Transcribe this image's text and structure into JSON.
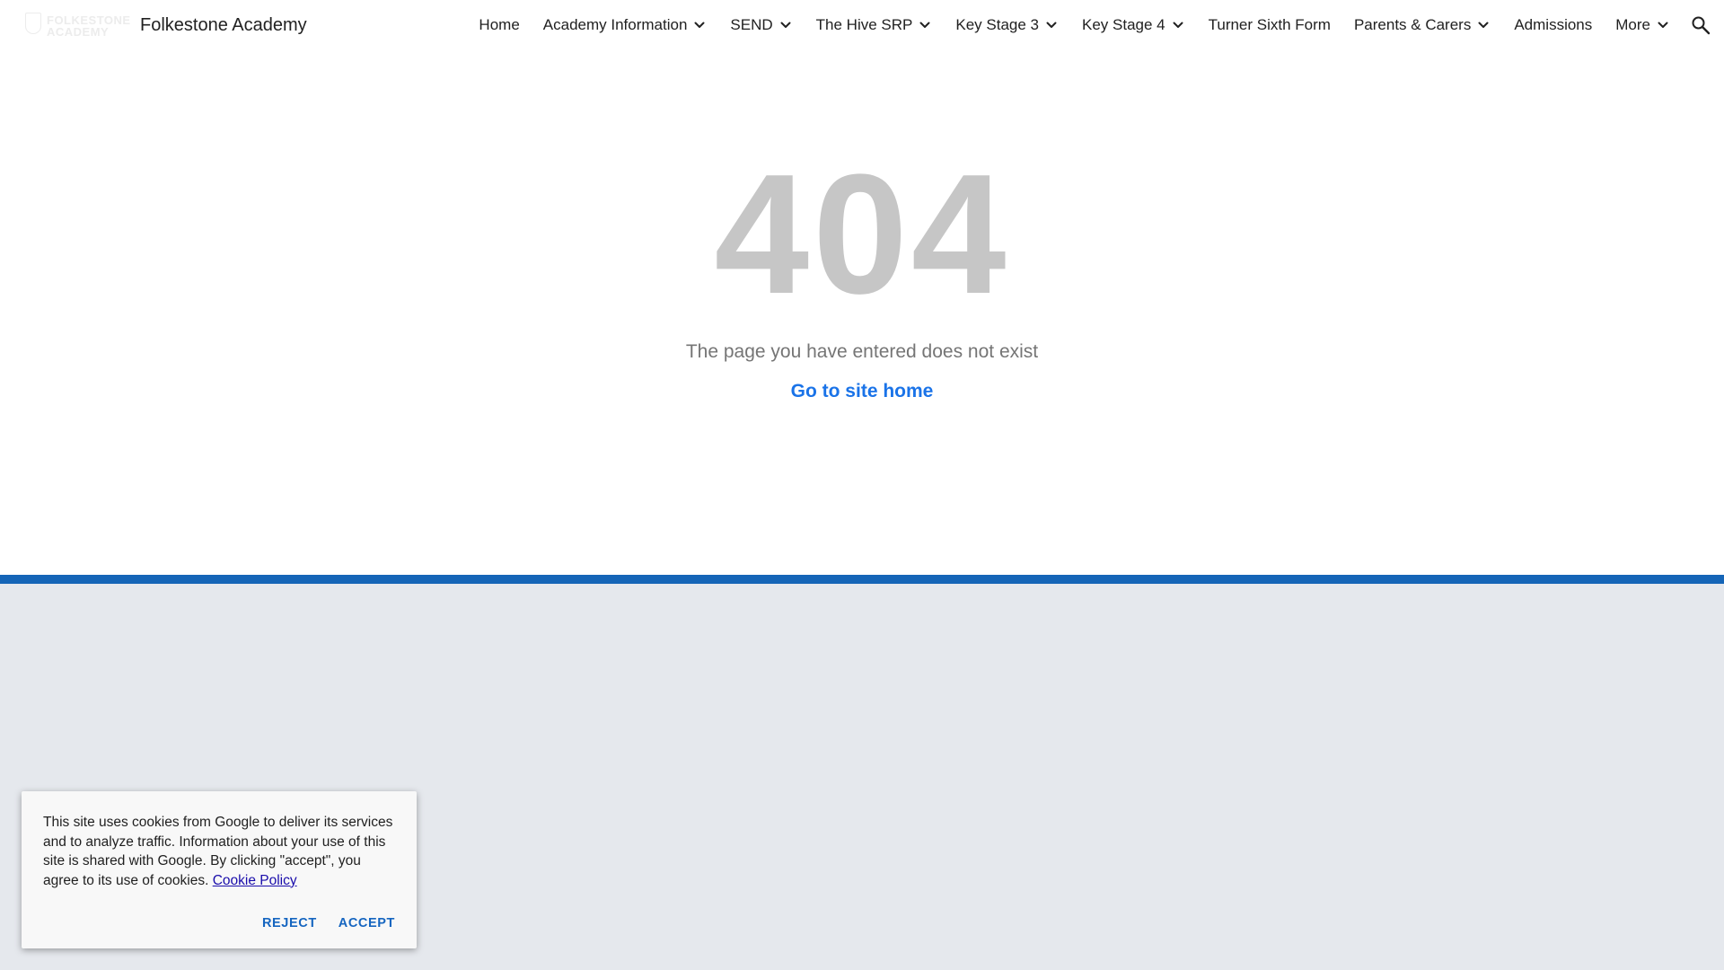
{
  "header": {
    "logo_line1": "FOLKESTONE",
    "logo_line2": "ACADEMY",
    "site_title": "Folkestone Academy",
    "nav": [
      {
        "label": "Home",
        "has_dropdown": false
      },
      {
        "label": "Academy Information",
        "has_dropdown": true
      },
      {
        "label": "SEND",
        "has_dropdown": true
      },
      {
        "label": "The Hive SRP",
        "has_dropdown": true
      },
      {
        "label": "Key Stage 3",
        "has_dropdown": true
      },
      {
        "label": "Key Stage 4",
        "has_dropdown": true
      },
      {
        "label": "Turner Sixth Form",
        "has_dropdown": false
      },
      {
        "label": "Parents & Carers",
        "has_dropdown": true
      },
      {
        "label": "Admissions",
        "has_dropdown": false
      },
      {
        "label": "More",
        "has_dropdown": true
      }
    ],
    "search_icon": "search-icon"
  },
  "main": {
    "error_code": "404",
    "message": "The page you have entered does not exist",
    "home_link": "Go to site home"
  },
  "cookie": {
    "text": "This site uses cookies from Google to deliver its services and to analyze traffic. Information about your use of this site is shared with Google. By clicking \"accept\", you agree to its use of cookies.",
    "link": "Cookie Policy",
    "reject": "REJECT",
    "accept": "ACCEPT"
  },
  "colors": {
    "accent_bar": "#1565b7",
    "footer_bg": "#e5e8ed",
    "link": "#1a73e8",
    "error_code": "#c6c6c6"
  }
}
